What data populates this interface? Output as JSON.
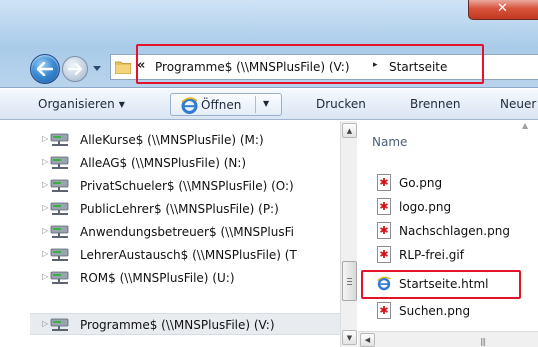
{
  "window": {
    "close_label": "✕"
  },
  "address": {
    "overflow_chevron": "«",
    "segments": [
      "Programme$ (\\\\MNSPlusFile) (V:)",
      "Startseite"
    ],
    "separator": "▸"
  },
  "toolbar": {
    "organize_label": "Organisieren",
    "open_label": "Öffnen",
    "print_label": "Drucken",
    "burn_label": "Brennen",
    "new_label": "Neuer"
  },
  "nav": {
    "items": [
      {
        "label": "AlleKurse$ (\\\\MNSPlusFile) (M:)"
      },
      {
        "label": "AlleAG$ (\\\\MNSPlusFile) (N:)"
      },
      {
        "label": "PrivatSchueler$ (\\\\MNSPlusFile) (O:)"
      },
      {
        "label": "PublicLehrer$ (\\\\MNSPlusFile) (P:)"
      },
      {
        "label": "Anwendungsbetreuer$ (\\\\MNSPlusFi"
      },
      {
        "label": "LehrerAustausch$ (\\\\MNSPlusFile) (T"
      },
      {
        "label": "ROM$ (\\\\MNSPlusFile) (U:)"
      },
      {
        "label": "Programme$ (\\\\MNSPlusFile) (V:)"
      }
    ],
    "selected_index": 7
  },
  "files": {
    "column_header": "Name",
    "items": [
      {
        "name": "Go.png",
        "icon": "image-file-icon"
      },
      {
        "name": "logo.png",
        "icon": "image-file-icon"
      },
      {
        "name": "Nachschlagen.png",
        "icon": "image-file-icon"
      },
      {
        "name": "RLP-frei.gif",
        "icon": "image-file-icon"
      },
      {
        "name": "Startseite.html",
        "icon": "html-file-icon"
      },
      {
        "name": "Suchen.png",
        "icon": "image-file-icon"
      }
    ],
    "highlighted_index": 4
  },
  "colors": {
    "highlight_red": "#e2132b",
    "titlebar_blue": "#b9d4ec",
    "toolbar_bg": "#e6eef8"
  }
}
